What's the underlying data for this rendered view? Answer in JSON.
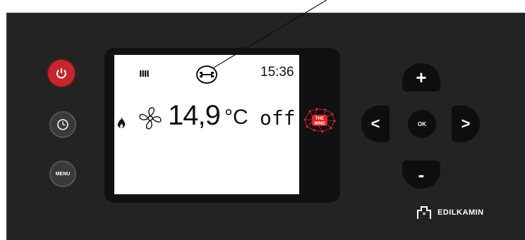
{
  "controls": {
    "power_icon": "power-icon",
    "clock_icon": "clock-icon",
    "menu_label": "MENU"
  },
  "display": {
    "status_indicator": "IIII",
    "time": "15:36",
    "temperature": "14,9",
    "unit": "°C",
    "state": "off",
    "maintenance_icon": "wrench-icon",
    "flame_icon": "flame-icon",
    "fan_icon": "fan-icon"
  },
  "logo": {
    "line1": "THE",
    "line2": "MIND"
  },
  "nav": {
    "up_label": "+",
    "down_label": "-",
    "left_label": "<",
    "right_label": ">",
    "ok_label": "OK"
  },
  "brand": {
    "name": "EDILKAMIN"
  },
  "colors": {
    "accent": "#c6272d",
    "panel": "#232323",
    "screen": "#ffffff"
  }
}
